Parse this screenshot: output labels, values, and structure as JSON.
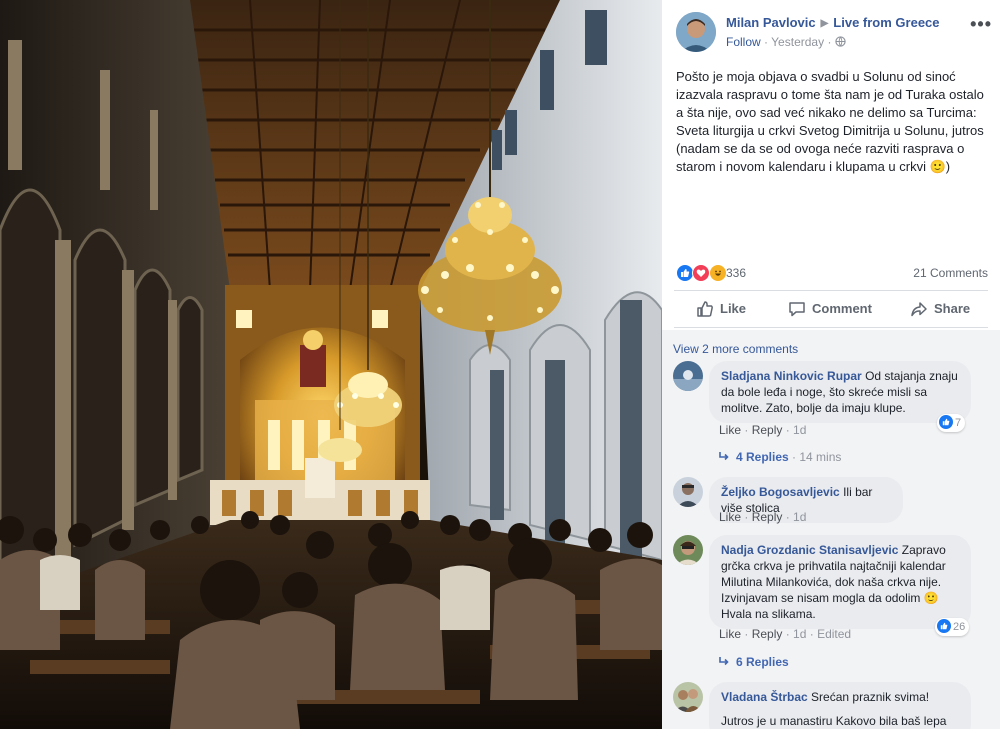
{
  "post": {
    "author": "Milan Pavlovic",
    "group": "Live from Greece",
    "follow_label": "Follow",
    "time": "Yesterday",
    "text": "Pošto je moja objava o svadbi u Solunu od sinoć izazvala raspravu o tome šta nam je od Turaka ostalo a šta nije, ovo sad već nikako ne delimo sa Turcima: Sveta liturgija u crkvi Svetog Dimitrija u Solunu, jutros (nadam se da se od ovoga neće razviti rasprava o starom i novom kalendaru i klupama u crkvi 🙂)",
    "reaction_count": "336",
    "comments_count": "21 Comments",
    "more_icon": "more-options-icon"
  },
  "actions": {
    "like": "Like",
    "comment": "Comment",
    "share": "Share"
  },
  "comments_section": {
    "view_more": "View 2 more comments",
    "comments": [
      {
        "name": "Sladjana Ninkovic Rupar",
        "text": "Od stajanja znaju da bole leđa i noge, što skreće misli sa molitve. Zato, bolje da imaju klupe.",
        "like": "Like",
        "reply": "Reply",
        "time": "1d",
        "likes": "7",
        "replies_label": "4 Replies",
        "replies_time": "14 mins"
      },
      {
        "name": "Željko Bogosavljevic",
        "text": "Ili bar više stolica",
        "like": "Like",
        "reply": "Reply",
        "time": "1d"
      },
      {
        "name": "Nadja Grozdanic Stanisavljevic",
        "text": "Zapravo grčka crkva je prihvatila najtačniji kalendar Milutina Milankovića, dok naša crkva nije. Izvinjavam se nisam mogla da odolim 🙂 Hvala na slikama.",
        "like": "Like",
        "reply": "Reply",
        "time": "1d",
        "edited": "Edited",
        "likes": "26",
        "replies_label": "6 Replies"
      },
      {
        "name": "Vladana Štrbac",
        "text": "Srećan praznik svima!",
        "text2": "Jutros je u manastiru Kakovo bila baš lepa"
      }
    ]
  },
  "colors": {
    "link": "#365899",
    "blue": "#4267b2",
    "muted": "#90949c",
    "bubble": "#e9ebee",
    "comments_bg": "#f2f3f5"
  }
}
